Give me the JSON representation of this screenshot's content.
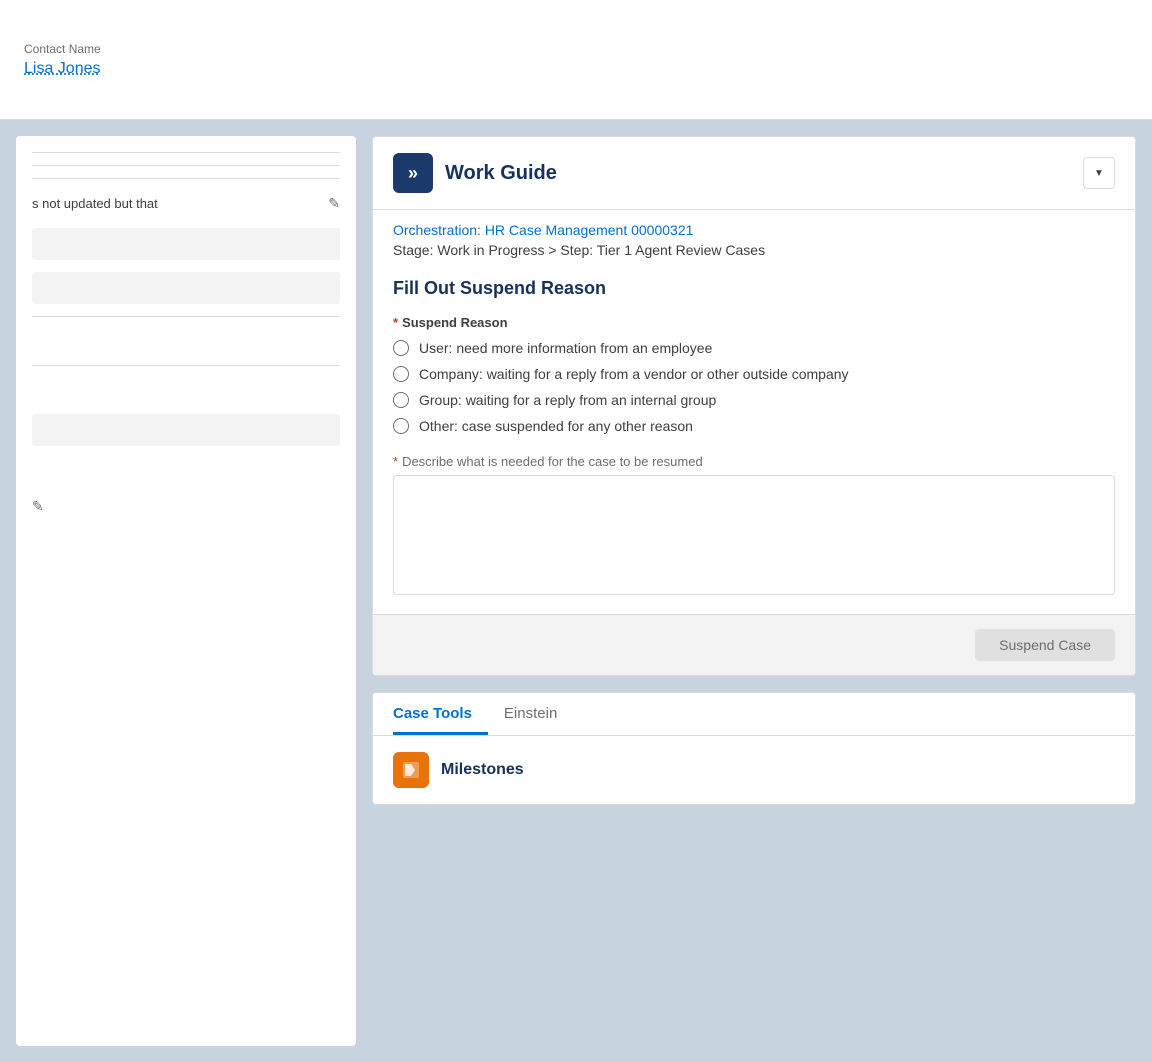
{
  "top_bar": {
    "contact_label": "Contact Name",
    "contact_name": "Lisa Jones"
  },
  "left_panel": {
    "field_text": "s not updated but that",
    "edit_icon": "✎"
  },
  "work_guide": {
    "icon_text": "»",
    "title": "Work Guide",
    "dropdown_icon": "▼",
    "orchestration_link": "Orchestration: HR Case Management 00000321",
    "stage_text": "Stage: Work in Progress > Step: Tier 1 Agent Review Cases",
    "section_title": "Fill Out Suspend Reason",
    "suspend_reason_label": "Suspend Reason",
    "required_star": "*",
    "radio_options": [
      "User: need more information from an employee",
      "Company: waiting for a reply from a vendor or other outside company",
      "Group: waiting for a reply from an internal group",
      "Other: case suspended for any other reason"
    ],
    "textarea_label": "Describe what is needed for the case to be resumed",
    "textarea_placeholder": "",
    "suspend_button": "Suspend Case"
  },
  "case_tools": {
    "tabs": [
      {
        "label": "Case Tools",
        "active": true
      },
      {
        "label": "Einstein",
        "active": false
      }
    ],
    "milestones_icon": "🏴",
    "milestones_title": "Milestones"
  }
}
